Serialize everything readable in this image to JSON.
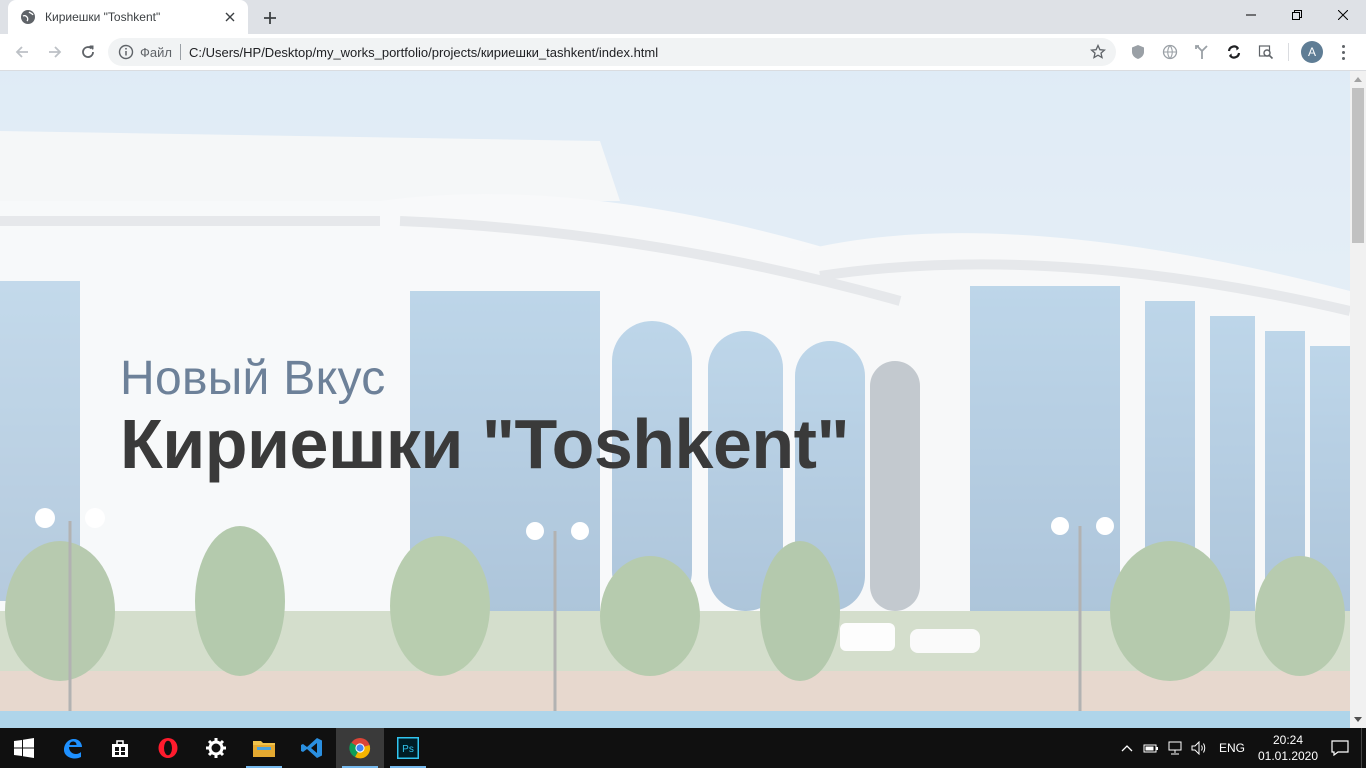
{
  "browser": {
    "tab": {
      "title": "Кириешки \"Toshkent\"",
      "favicon": "globe-icon",
      "close_icon": "close-icon"
    },
    "new_tab_icon": "plus-icon",
    "window_controls": [
      "minimize-icon",
      "restore-icon",
      "close-icon"
    ],
    "toolbar": {
      "back_icon": "arrow-left-icon",
      "forward_icon": "arrow-right-icon",
      "reload_icon": "reload-icon",
      "scheme_label": "Файл",
      "url": "C:/Users/HP/Desktop/my_works_portfolio/projects/кириешки_tashkent/index.html",
      "bookmark_icon": "star-icon"
    },
    "extensions": [
      "shield-icon",
      "globe-icon",
      "tools-icon",
      "sync-icon",
      "search-page-icon"
    ],
    "profile_initial": "A"
  },
  "page": {
    "hero": {
      "subtitle": "Новый Вкус",
      "title": "Кириешки \"Toshkent\""
    }
  },
  "taskbar": {
    "items": [
      {
        "name": "start-button",
        "icon": "windows-icon"
      },
      {
        "name": "edge-app",
        "icon": "edge-icon"
      },
      {
        "name": "store-app",
        "icon": "store-icon"
      },
      {
        "name": "opera-app",
        "icon": "opera-icon"
      },
      {
        "name": "settings-app",
        "icon": "gear-icon"
      },
      {
        "name": "explorer-app",
        "icon": "folder-icon"
      },
      {
        "name": "vscode-app",
        "icon": "vscode-icon"
      },
      {
        "name": "chrome-app",
        "icon": "chrome-icon"
      },
      {
        "name": "photoshop-app",
        "icon": "photoshop-icon",
        "label": "Ps"
      }
    ],
    "tray": {
      "language": "ENG",
      "time": "20:24",
      "date": "01.01.2020"
    }
  },
  "colors": {
    "accent": "#76b9ed",
    "subtitle": "#6d8199",
    "title": "#3a3a3a"
  }
}
